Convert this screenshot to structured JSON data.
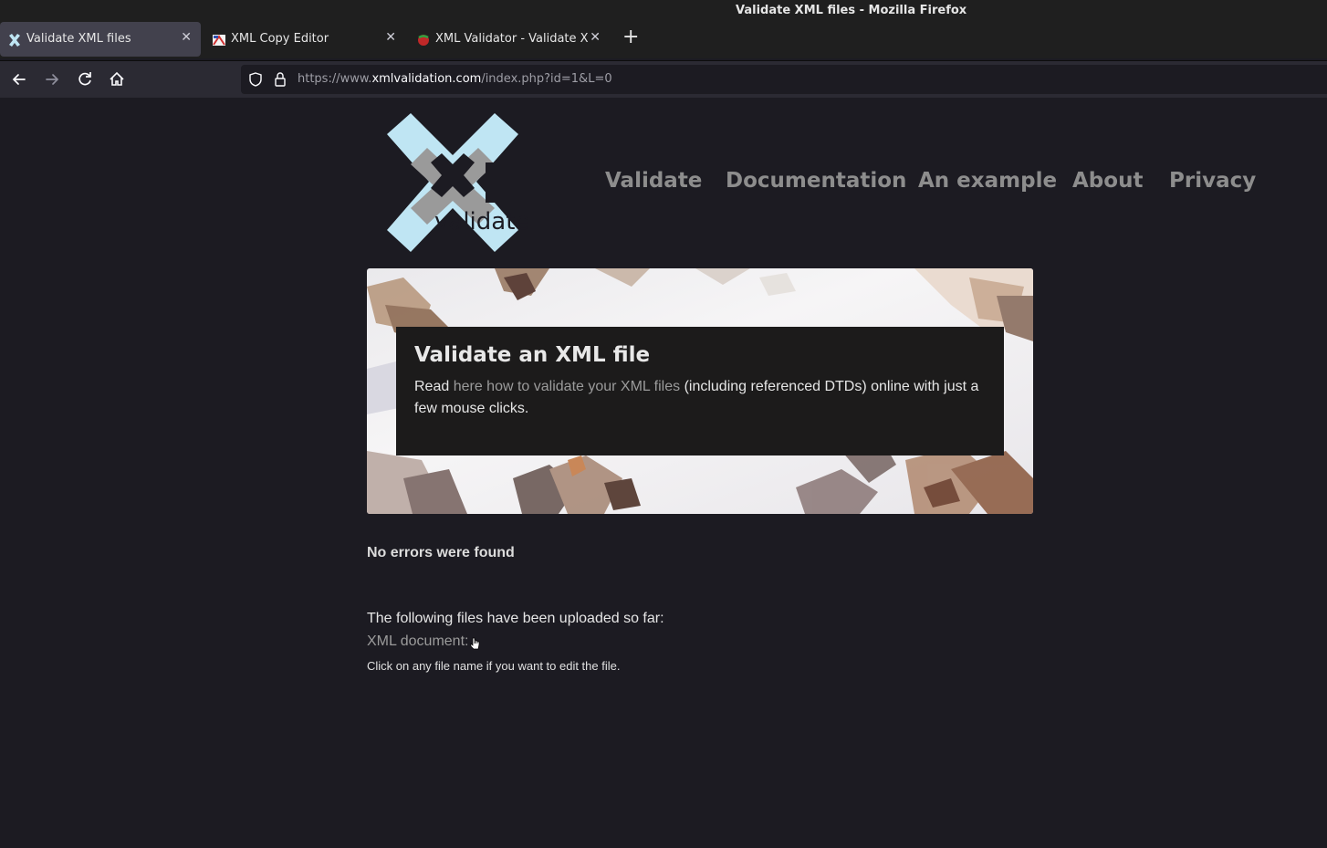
{
  "window": {
    "title": "Validate XML files - Mozilla Firefox"
  },
  "tabs": [
    {
      "label": "Validate XML files",
      "active": true,
      "icon": "xml-validation-favicon"
    },
    {
      "label": "XML Copy Editor",
      "active": false,
      "icon": "xml-copy-editor-favicon"
    },
    {
      "label": "XML Validator - Validate XML",
      "active": false,
      "icon": "xml-validator-favicon"
    }
  ],
  "toolbar": {
    "back_icon": "back-arrow-icon",
    "forward_icon": "forward-arrow-icon",
    "reload_icon": "reload-icon",
    "home_icon": "home-icon"
  },
  "url": {
    "scheme": "https://www.",
    "host": "xmlvalidation.com",
    "path": "/index.php?id=1&L=0"
  },
  "site": {
    "logo_text": "validate",
    "nav": [
      "Validate",
      "Documentation",
      "An example",
      "About",
      "Privacy"
    ]
  },
  "hero": {
    "title": "Validate an XML file",
    "text_before": "Read ",
    "link": "here how to validate your XML files",
    "text_after": " (including referenced DTDs) online with just a few mouse clicks."
  },
  "result": {
    "status": "No errors were found",
    "uploaded_label": "The following files have been uploaded so far:",
    "xml_document": "XML document:",
    "hint": "Click on any file name if you want to edit the file."
  },
  "colors": {
    "page_bg": "#1c1b22",
    "link": "#9b9b9b",
    "nav": "#8d8d8d",
    "logo_blue": "#bfe5f3"
  }
}
